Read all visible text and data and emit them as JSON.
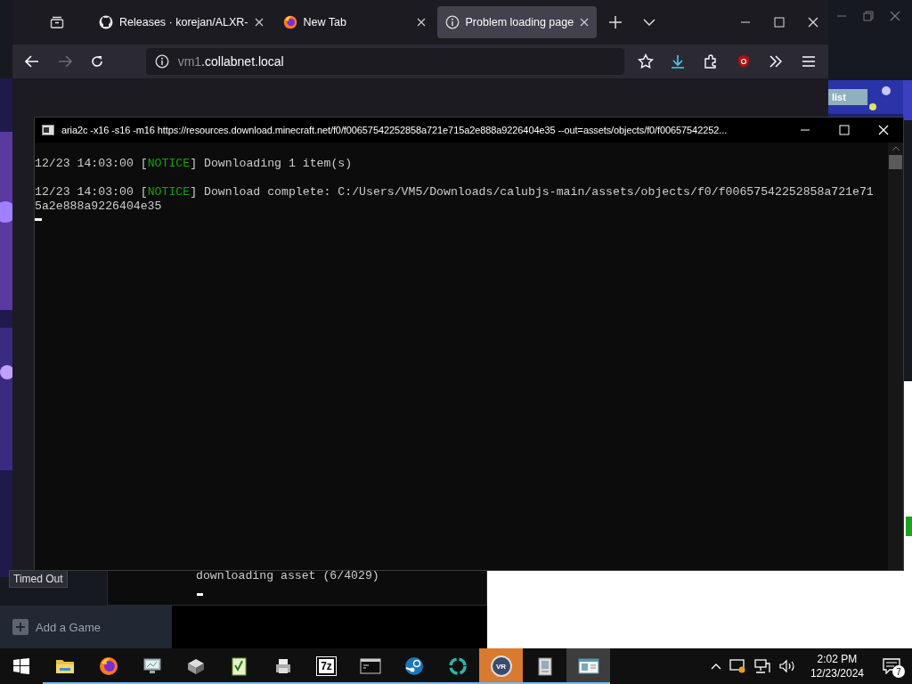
{
  "back_window": {
    "tab_button": "list",
    "tooltip": "Timed Out",
    "add_game": "Add a Game",
    "console_line": "downloading asset (6/4029)"
  },
  "browser": {
    "tabs": [
      {
        "kind": "github",
        "title": "Releases · korejan/ALXR-",
        "selected": false
      },
      {
        "kind": "firefox",
        "title": "New Tab",
        "selected": false
      },
      {
        "kind": "info",
        "title": "Problem loading page",
        "selected": true
      }
    ],
    "url": {
      "subdomain": "vm1",
      "domain": ".collabnet.local"
    }
  },
  "console": {
    "title": "aria2c  -x16 -s16 -m16 https://resources.download.minecraft.net/f0/f00657542252858a721e715a2e888a9226404e35 --out=assets/objects/f0/f00657542252...",
    "lines": [
      {
        "time": "12/23 14:03:00",
        "open": "[",
        "level": "NOTICE",
        "close": "]",
        "message": "Downloading 1 item(s)"
      },
      {
        "time": "12/23 14:03:00",
        "open": "[",
        "level": "NOTICE",
        "close": "]",
        "message": "Download complete: C:/Users/VM5/Downloads/calubjs-main/assets/objects/f0/f00657542252858a721e715a2e888a9226404e35"
      }
    ]
  },
  "taskbar": {
    "apps": [
      {
        "kind": "folder",
        "running": true,
        "selected": false,
        "flashing": false
      },
      {
        "kind": "firefox",
        "running": true,
        "selected": false,
        "flashing": false
      },
      {
        "kind": "monitor",
        "running": true,
        "selected": false,
        "flashing": false
      },
      {
        "kind": "box",
        "running": true,
        "selected": false,
        "flashing": false
      },
      {
        "kind": "notepad",
        "running": true,
        "selected": false,
        "flashing": false
      },
      {
        "kind": "device",
        "running": true,
        "selected": false,
        "flashing": false
      },
      {
        "kind": "archive",
        "glyph": "7z",
        "running": true,
        "selected": false,
        "flashing": false
      },
      {
        "kind": "terminal",
        "running": true,
        "selected": false,
        "flashing": false
      },
      {
        "kind": "steam",
        "running": true,
        "selected": false,
        "flashing": false
      },
      {
        "kind": "ring",
        "running": true,
        "selected": false,
        "flashing": false
      },
      {
        "kind": "vr",
        "glyph": "VR",
        "running": true,
        "selected": false,
        "flashing": true
      },
      {
        "kind": "document",
        "running": true,
        "selected": false,
        "flashing": false
      },
      {
        "kind": "window",
        "running": true,
        "selected": true,
        "flashing": false
      }
    ],
    "time": "2:02 PM",
    "date": "12/23/2024",
    "notifications": "7"
  }
}
